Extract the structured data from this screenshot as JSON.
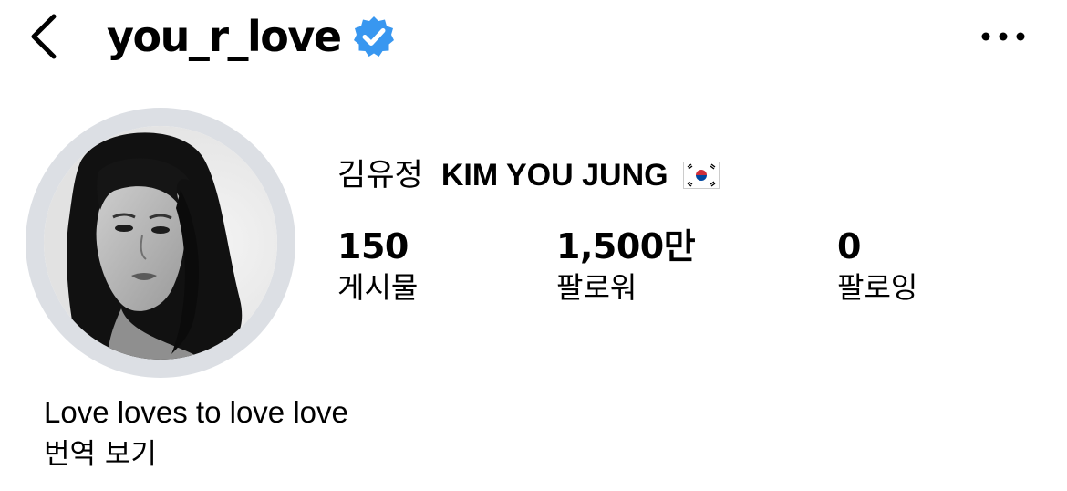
{
  "header": {
    "back_icon": "chevron-left-icon",
    "username": "you_r_love",
    "verified_icon": "verified-badge-icon",
    "more_icon": "more-horizontal-icon"
  },
  "profile": {
    "name_korean": "김유정",
    "name_english": "KIM YOU JUNG",
    "flag_icon": "south-korea-flag-icon"
  },
  "stats": {
    "posts": {
      "value": "150",
      "label": "게시물"
    },
    "followers": {
      "value": "1,500만",
      "label": "팔로워"
    },
    "following": {
      "value": "0",
      "label": "팔로잉"
    }
  },
  "bio": {
    "text": "Love loves to love love",
    "translate_label": "번역 보기"
  },
  "colors": {
    "verified_blue": "#3897f0",
    "avatar_ring": "#dcdfe4",
    "text": "#000000",
    "background": "#ffffff"
  }
}
